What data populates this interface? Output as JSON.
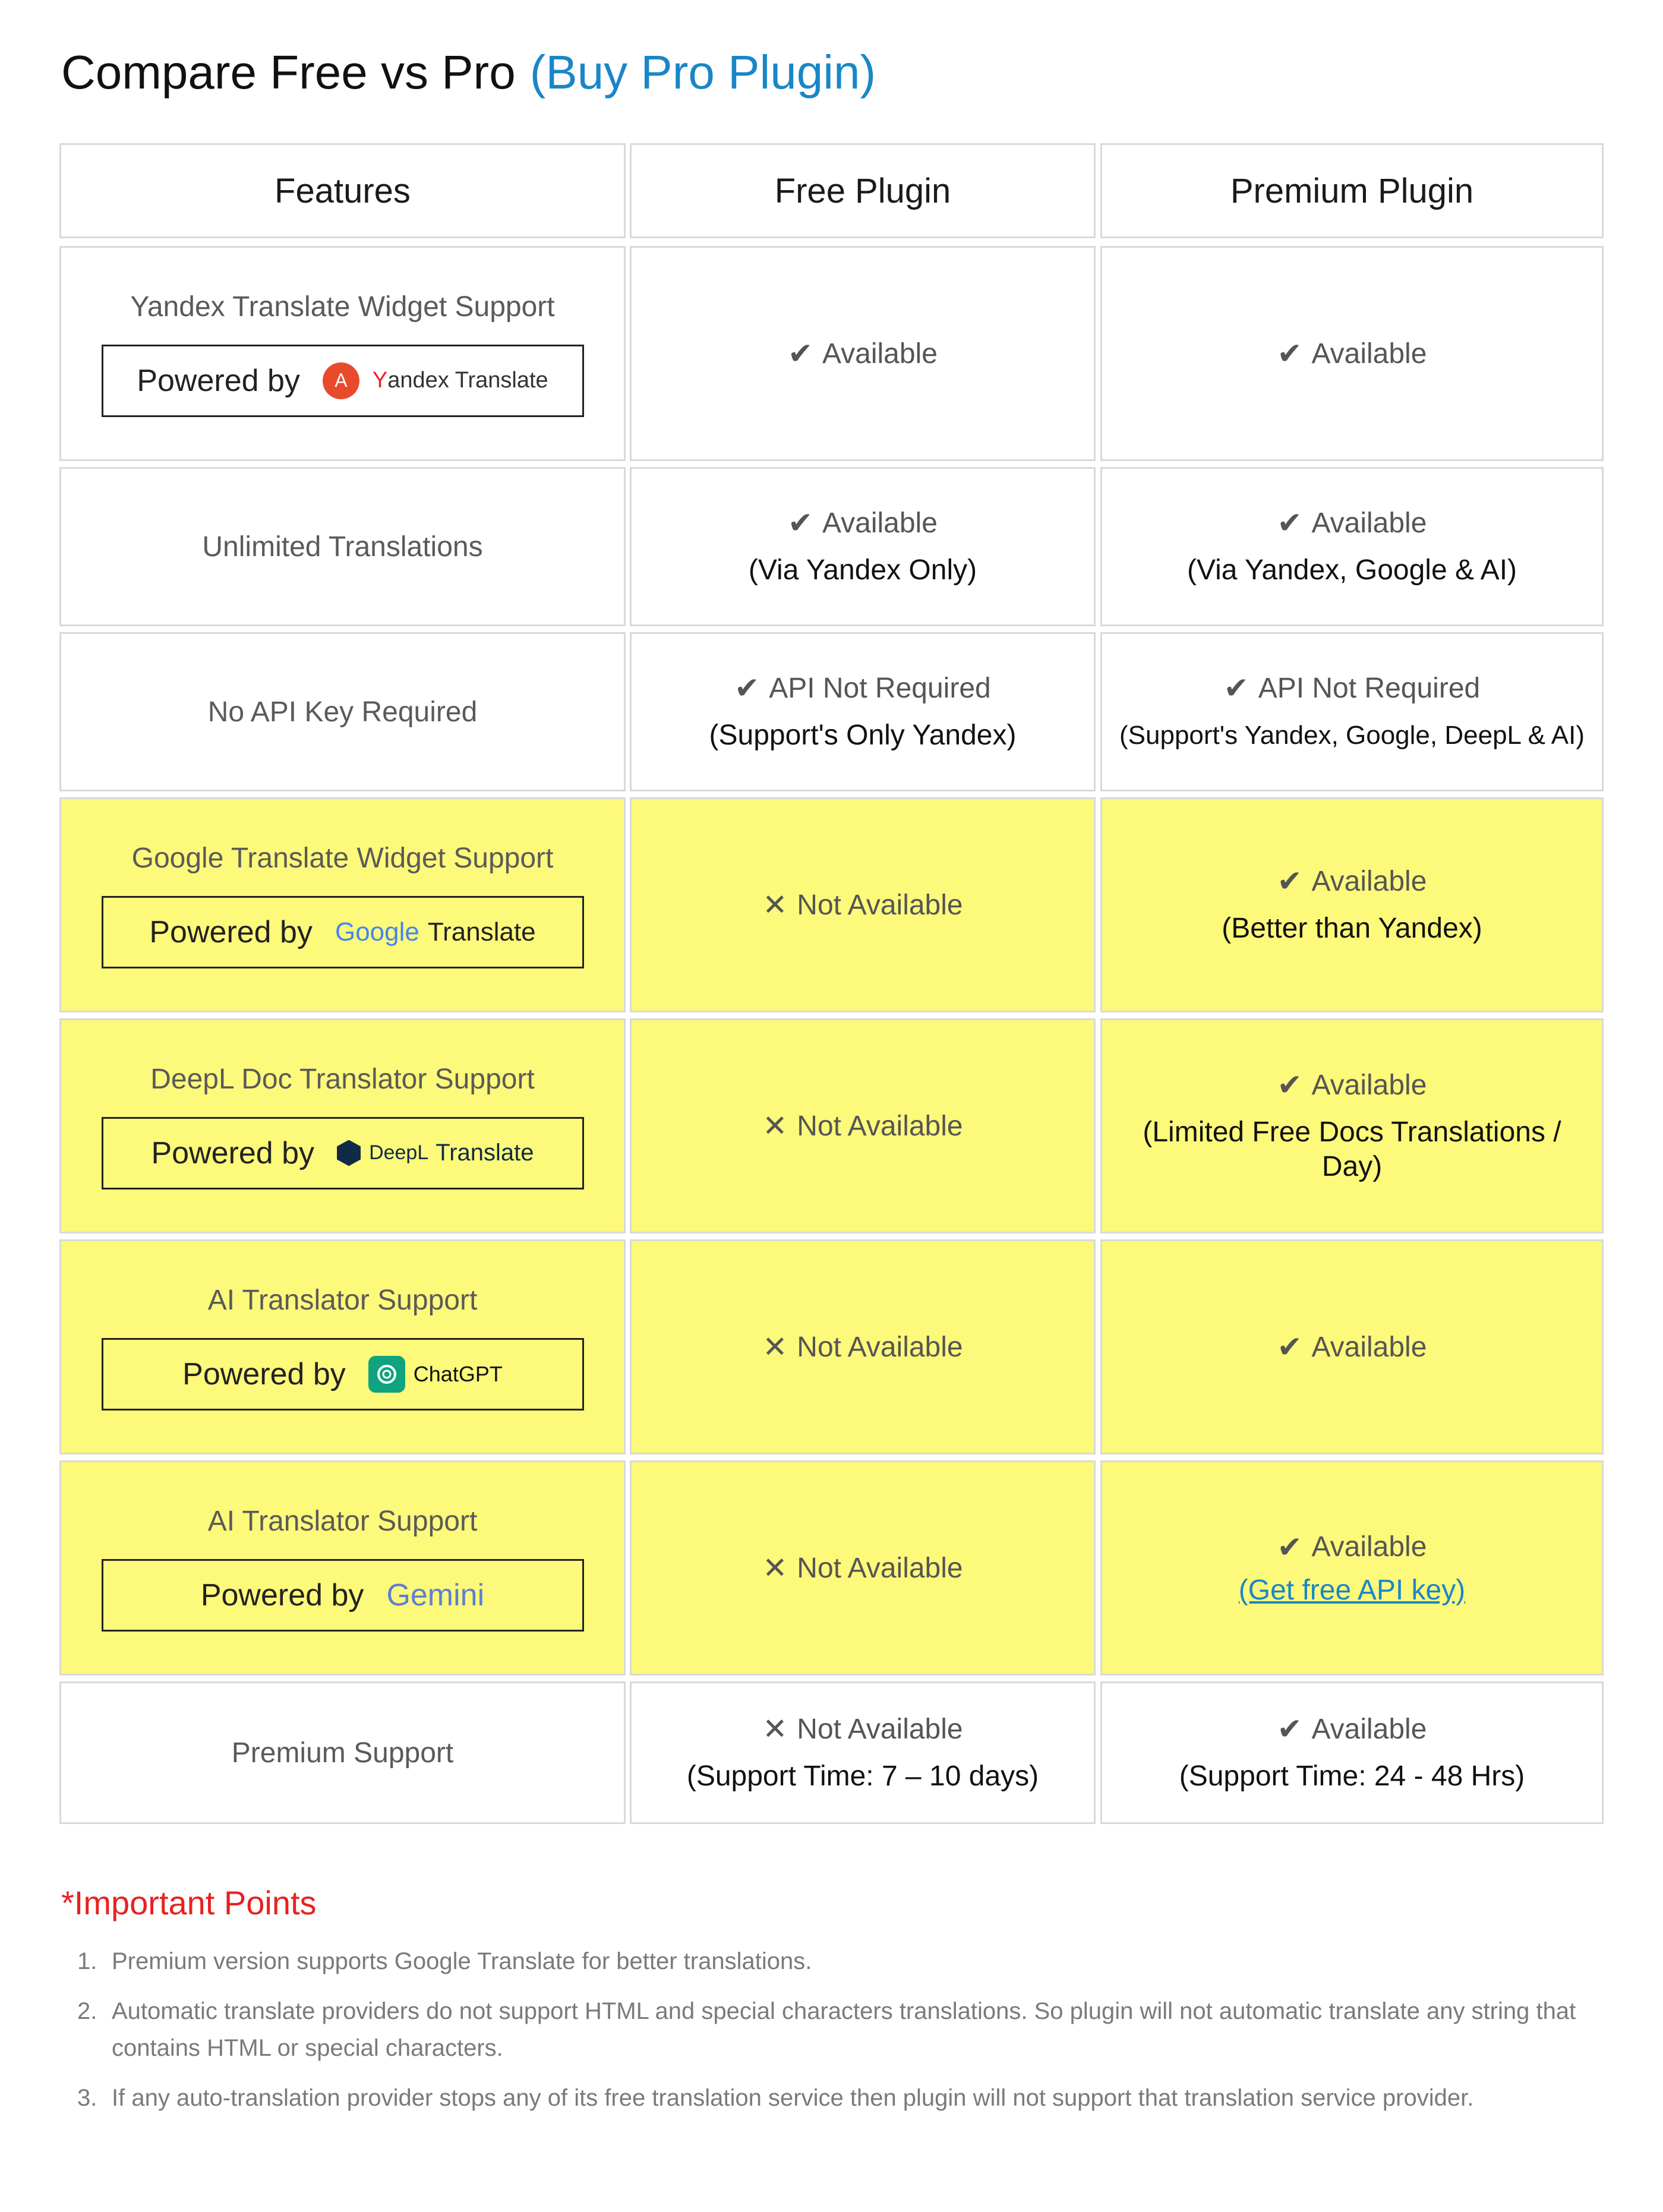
{
  "title": {
    "text": "Compare Free vs Pro",
    "buy_link": "(Buy Pro Plugin)"
  },
  "colors": {
    "highlight": "#fdf97a",
    "link": "#1a86c8",
    "important": "#e82121",
    "border": "#d9d9d9"
  },
  "headers": {
    "features": "Features",
    "free": "Free Plugin",
    "premium": "Premium Plugin"
  },
  "rows": [
    {
      "feature": "Yandex Translate Widget Support",
      "powered_by": "Powered by",
      "logo": {
        "icon": "yandex-translate-icon",
        "brand_y": "Y",
        "brand_rest": "andex Translate"
      },
      "free": {
        "mark": "✔",
        "status": "Available"
      },
      "premium": {
        "mark": "✔",
        "status": "Available"
      }
    },
    {
      "feature": "Unlimited Translations",
      "free": {
        "mark": "✔",
        "status": "Available",
        "note": "(Via Yandex Only)"
      },
      "premium": {
        "mark": "✔",
        "status": "Available",
        "note": "(Via Yandex, Google & AI)"
      }
    },
    {
      "feature": "No API Key Required",
      "free": {
        "mark": "✔",
        "status": "API Not Required",
        "note": "(Support's Only Yandex)"
      },
      "premium": {
        "mark": "✔",
        "status": "API Not Required",
        "note": "(Support's Yandex, Google, DeepL & AI)"
      }
    },
    {
      "feature": "Google Translate Widget Support",
      "powered_by": "Powered by",
      "logo": {
        "icon": "google-logo",
        "word": "Google",
        "suffix": "Translate"
      },
      "free": {
        "mark": "✕",
        "status": "Not Available"
      },
      "premium": {
        "mark": "✔",
        "status": "Available",
        "note": "(Better than Yandex)"
      }
    },
    {
      "feature": "DeepL Doc Translator Support",
      "powered_by": "Powered by",
      "logo": {
        "icon": "deepl-icon",
        "word": "DeepL",
        "suffix": "Translate"
      },
      "free": {
        "mark": "✕",
        "status": "Not Available"
      },
      "premium": {
        "mark": "✔",
        "status": "Available",
        "note": "(Limited Free Docs Translations / Day)"
      }
    },
    {
      "feature": "AI Translator Support",
      "powered_by": "Powered by",
      "logo": {
        "icon": "chatgpt-icon",
        "word": "ChatGPT"
      },
      "free": {
        "mark": "✕",
        "status": "Not Available"
      },
      "premium": {
        "mark": "✔",
        "status": "Available"
      }
    },
    {
      "feature": "AI Translator Support",
      "powered_by": "Powered by",
      "logo": {
        "icon": "gemini-logo",
        "word": "Gemini"
      },
      "free": {
        "mark": "✕",
        "status": "Not Available"
      },
      "premium": {
        "mark": "✔",
        "status": "Available",
        "link": "(Get free API key)"
      }
    },
    {
      "feature": "Premium Support",
      "free": {
        "mark": "✕",
        "status": "Not Available",
        "note": "(Support Time: 7 – 10 days)"
      },
      "premium": {
        "mark": "✔",
        "status": "Available",
        "note": "(Support Time: 24 - 48 Hrs)"
      }
    }
  ],
  "important": {
    "heading": "*Important Points",
    "points": [
      {
        "num": "1.",
        "text": "Premium version supports Google Translate for better translations."
      },
      {
        "num": "2.",
        "text": "Automatic translate providers do not support HTML and special characters translations. So plugin will not automatic translate any string that contains HTML or special characters."
      },
      {
        "num": "3.",
        "text": "If any auto-translation provider stops any of its free translation service then plugin will not support that translation service provider."
      }
    ]
  }
}
